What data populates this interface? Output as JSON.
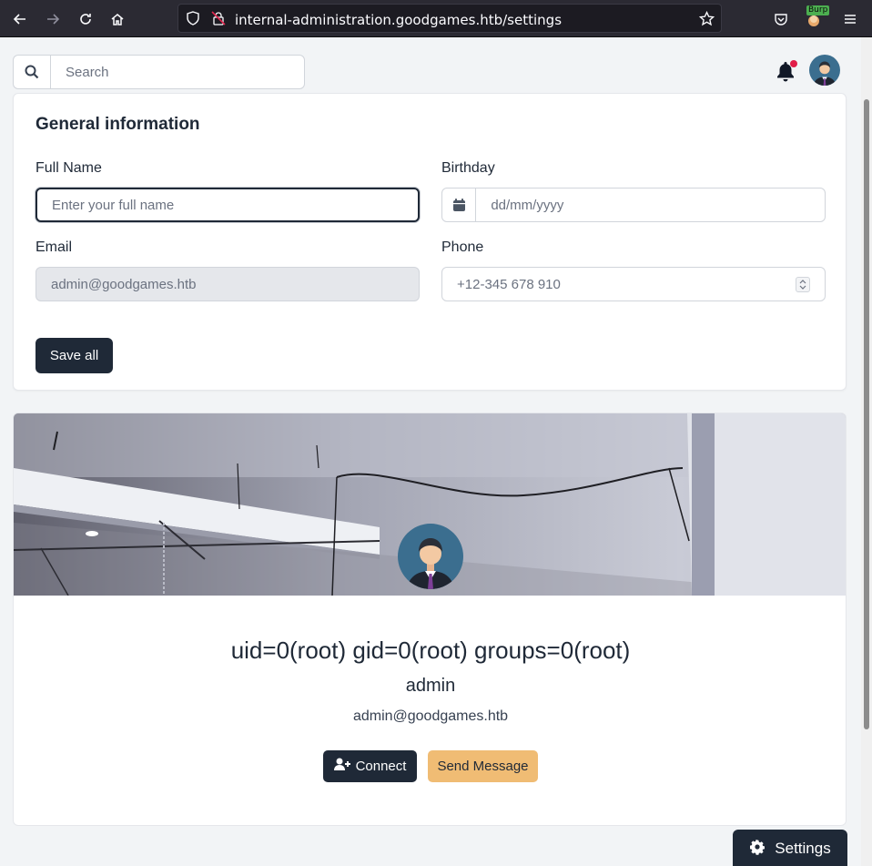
{
  "browser": {
    "url": "internal-administration.goodgames.htb/settings",
    "burp_badge": "Burp"
  },
  "search": {
    "placeholder": "Search"
  },
  "general": {
    "title": "General information",
    "full_name_label": "Full Name",
    "full_name_placeholder": "Enter your full name",
    "birthday_label": "Birthday",
    "birthday_placeholder": "dd/mm/yyyy",
    "email_label": "Email",
    "email_placeholder": "admin@goodgames.htb",
    "phone_label": "Phone",
    "phone_placeholder": "+12-345 678 910",
    "save_label": "Save all"
  },
  "profile": {
    "title": "uid=0(root) gid=0(root) groups=0(root)",
    "subtitle": "admin",
    "email": "admin@goodgames.htb",
    "connect_label": "Connect",
    "message_label": "Send Message"
  },
  "settings_label": "Settings",
  "colors": {
    "primary": "#1f2937",
    "accent": "#f0bc74",
    "notification": "#e11d48"
  }
}
